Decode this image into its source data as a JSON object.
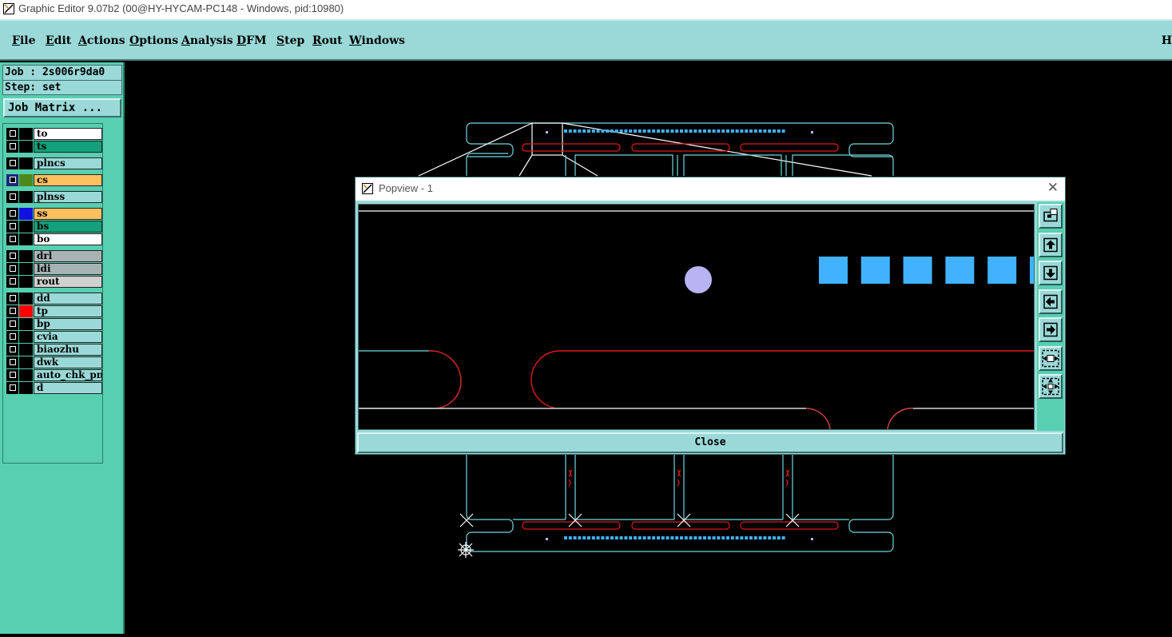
{
  "window": {
    "title": "Graphic Editor 9.07b2 (00@HY-HYCAM-PC148 - Windows, pid:10980)"
  },
  "menu": [
    {
      "pre": "",
      "u": "F",
      "post": "ile"
    },
    {
      "pre": "",
      "u": "E",
      "post": "dit"
    },
    {
      "pre": "",
      "u": "A",
      "post": "ctions"
    },
    {
      "pre": "",
      "u": "O",
      "post": "ptions"
    },
    {
      "pre": "",
      "u": "A",
      "post": "nalysis"
    },
    {
      "pre": "",
      "u": "D",
      "post": "FM"
    },
    {
      "pre": "",
      "u": "S",
      "post": "tep"
    },
    {
      "pre": "",
      "u": "R",
      "post": "out"
    },
    {
      "pre": "",
      "u": "W",
      "post": "indows"
    }
  ],
  "menu_edge": "H",
  "job": {
    "job_line": "Job : 2s006r9da0",
    "step_line": "Step: set",
    "matrix_button": "Job Matrix ..."
  },
  "layers": [
    {
      "name": "to",
      "color": "#ffffff",
      "swatch": "#000000",
      "group": 1
    },
    {
      "name": "ts",
      "color": "#14a07a",
      "swatch": "#000000",
      "group": 1
    },
    {
      "name": "plncs",
      "color": "#9ad9d8",
      "swatch": "#000000",
      "group": 2
    },
    {
      "name": "cs",
      "color": "#ffc060",
      "swatch": "#4a8a1c",
      "group": 3,
      "active": true
    },
    {
      "name": "plnss",
      "color": "#9ad9d8",
      "swatch": "#000000",
      "group": 4
    },
    {
      "name": "ss",
      "color": "#ffc060",
      "swatch": "#1010e0",
      "group": 5
    },
    {
      "name": "bs",
      "color": "#14a07a",
      "swatch": "#000000",
      "group": 5
    },
    {
      "name": "bo",
      "color": "#ffffff",
      "swatch": "#000000",
      "group": 5
    },
    {
      "name": "drl",
      "color": "#a8b4b4",
      "swatch": "#000000",
      "group": 6
    },
    {
      "name": "ldi",
      "color": "#a8b4b4",
      "swatch": "#000000",
      "group": 6
    },
    {
      "name": "rout",
      "color": "#d0d0d0",
      "swatch": "#000000",
      "group": 6
    },
    {
      "name": "dd",
      "color": "#9ad9d8",
      "swatch": "#000000",
      "group": 7
    },
    {
      "name": "tp",
      "color": "#9ad9d8",
      "swatch": "#ff0000",
      "group": 7
    },
    {
      "name": "bp",
      "color": "#9ad9d8",
      "swatch": "#000000",
      "group": 7
    },
    {
      "name": "cvia",
      "color": "#9ad9d8",
      "swatch": "#000000",
      "group": 7
    },
    {
      "name": "biaozhu",
      "color": "#9ad9d8",
      "swatch": "#000000",
      "group": 7
    },
    {
      "name": "dwk",
      "color": "#9ad9d8",
      "swatch": "#000000",
      "group": 7
    },
    {
      "name": "auto_chk_pnl",
      "color": "#9ad9d8",
      "swatch": "#000000",
      "group": 7
    },
    {
      "name": "d",
      "color": "#9ad9d8",
      "swatch": "#000000",
      "group": 7
    }
  ],
  "popview": {
    "title": "Popview - 1",
    "close_label": "Close",
    "tool_icons": [
      "zoom-home-icon",
      "pan-up-icon",
      "pan-down-icon",
      "pan-left-icon",
      "pan-right-icon",
      "zoom-in-icon",
      "zoom-out-icon"
    ]
  },
  "colors": {
    "panel": "#9ad9d8",
    "panel_dark": "#57cfb0",
    "outline_cyan": "#6fd8e0",
    "trace_red": "#e01818",
    "pad_blue": "#41b2ff",
    "pad_lilac": "#b8b4f4"
  }
}
